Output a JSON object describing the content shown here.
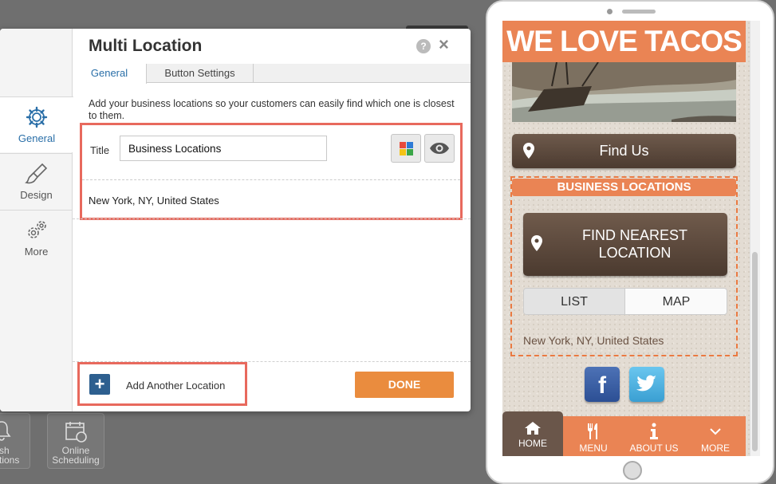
{
  "background": {
    "tiles": [
      {
        "label": "ush\nocations"
      },
      {
        "label": "Online\nScheduling"
      }
    ]
  },
  "editor": {
    "title": "Multi Location",
    "help_label": "?",
    "close_label": "×",
    "sidebar": {
      "items": [
        {
          "label": "General",
          "icon": "gear-icon",
          "active": true
        },
        {
          "label": "Design",
          "icon": "brush-icon",
          "active": false
        },
        {
          "label": "More",
          "icon": "gears-icon",
          "active": false
        }
      ]
    },
    "tabs": [
      {
        "label": "General",
        "active": true
      },
      {
        "label": "Button Settings",
        "active": false
      }
    ],
    "description": "Add your business locations so your customers can easily find which one is closest to them.",
    "title_field": {
      "label": "Title",
      "value": "Business Locations"
    },
    "locations": [
      "New York, NY, United States"
    ],
    "add_location_label": "Add Another Location",
    "add_icon_label": "+",
    "done_label": "DONE",
    "highlight_color": "#e8695d",
    "accent_color": "#2a6fa8",
    "done_color": "#ea8c3e"
  },
  "preview": {
    "header_title": "WE LOVE TACOS",
    "find_us_label": "Find Us",
    "module_title": "BUSINESS LOCATIONS",
    "find_nearest_label": "FIND NEAREST LOCATION",
    "list_label": "LIST",
    "map_label": "MAP",
    "location_text": "New York, NY, United States",
    "facebook_label": "f",
    "tabbar": [
      {
        "label": "HOME",
        "icon": "home-icon",
        "active": true
      },
      {
        "label": "MENU",
        "icon": "utensils-icon",
        "active": false
      },
      {
        "label": "ABOUT US",
        "icon": "info-icon",
        "active": false
      },
      {
        "label": "MORE",
        "icon": "chevron-down-icon",
        "active": false
      }
    ],
    "theme_color": "#ea8454",
    "button_color": "#5e4a3d"
  }
}
